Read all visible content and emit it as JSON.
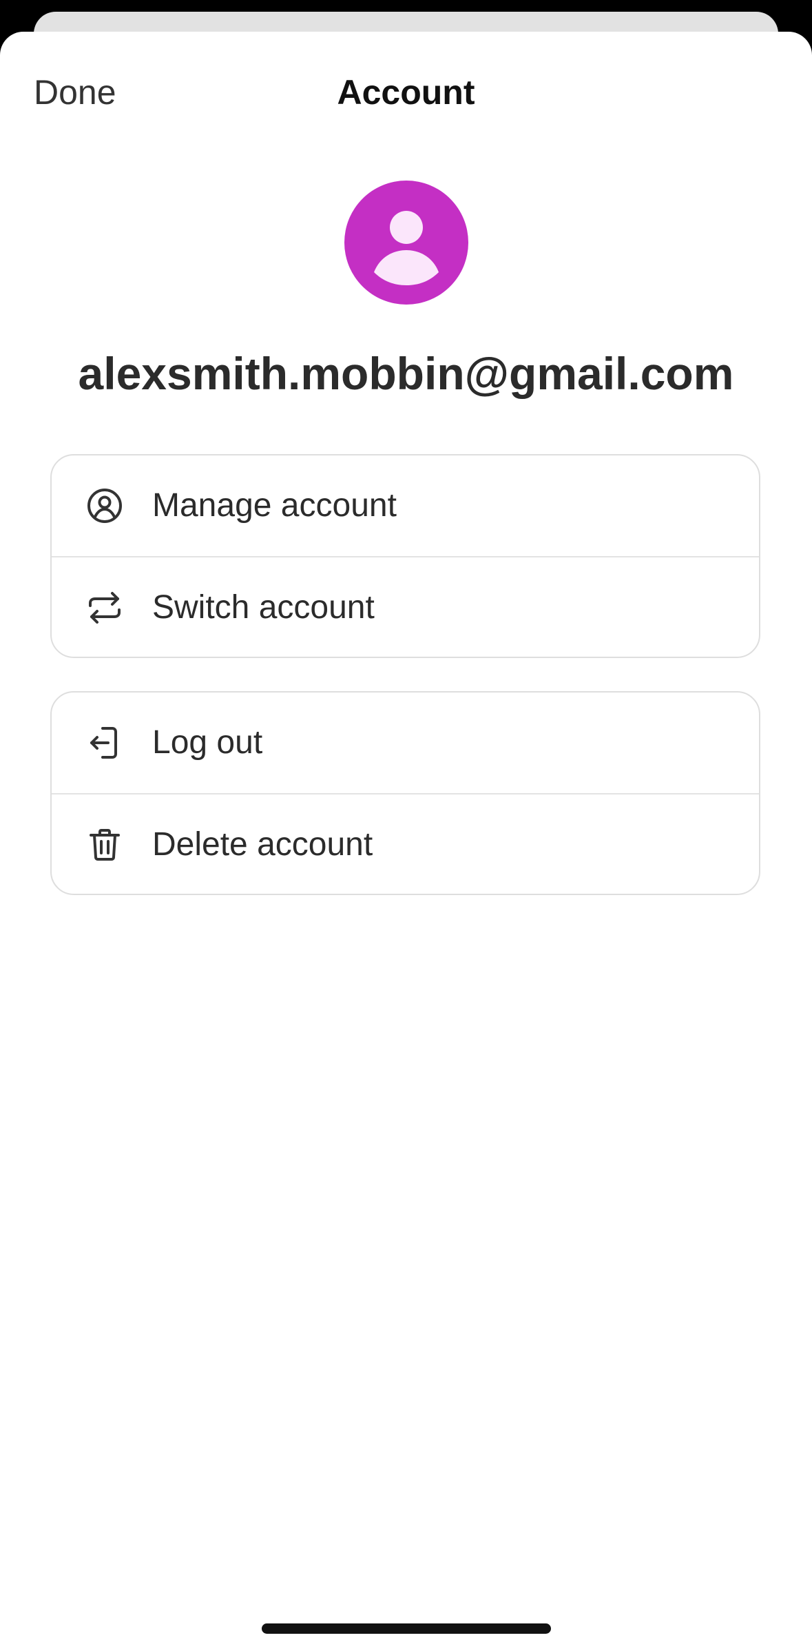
{
  "header": {
    "done_label": "Done",
    "title": "Account"
  },
  "profile": {
    "avatar_icon": "person-silhouette-icon",
    "avatar_color": "#c42fc4",
    "email": "alexsmith.mobbin@gmail.com"
  },
  "account_actions": [
    {
      "label": "Manage account",
      "icon": "user-circle-icon"
    },
    {
      "label": "Switch account",
      "icon": "switch-arrows-icon"
    }
  ],
  "session_actions": [
    {
      "label": "Log out",
      "icon": "log-out-icon"
    },
    {
      "label": "Delete account",
      "icon": "trash-icon"
    }
  ],
  "colors": {
    "text": "#2b2b2b",
    "border": "#dedede",
    "sheet_background": "#ffffff",
    "backdrop": "#000000"
  }
}
